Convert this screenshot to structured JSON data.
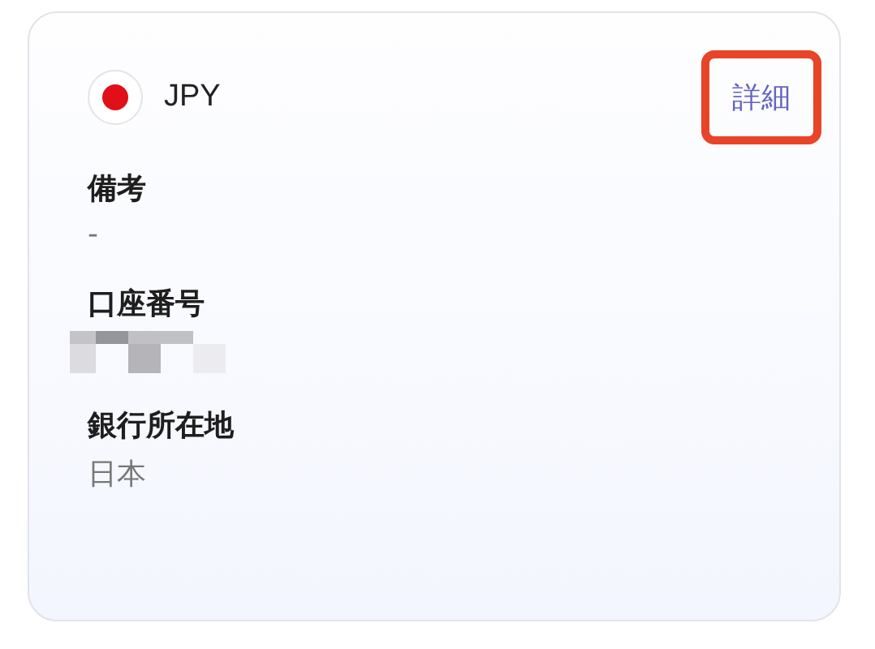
{
  "currency": {
    "code": "JPY"
  },
  "details_link": {
    "label": "詳細",
    "highlighted": true
  },
  "fields": [
    {
      "label": "備考",
      "kind": "text",
      "value": "-"
    },
    {
      "label": "口座番号",
      "kind": "redacted"
    },
    {
      "label": "銀行所在地",
      "kind": "text",
      "value": "日本"
    }
  ]
}
